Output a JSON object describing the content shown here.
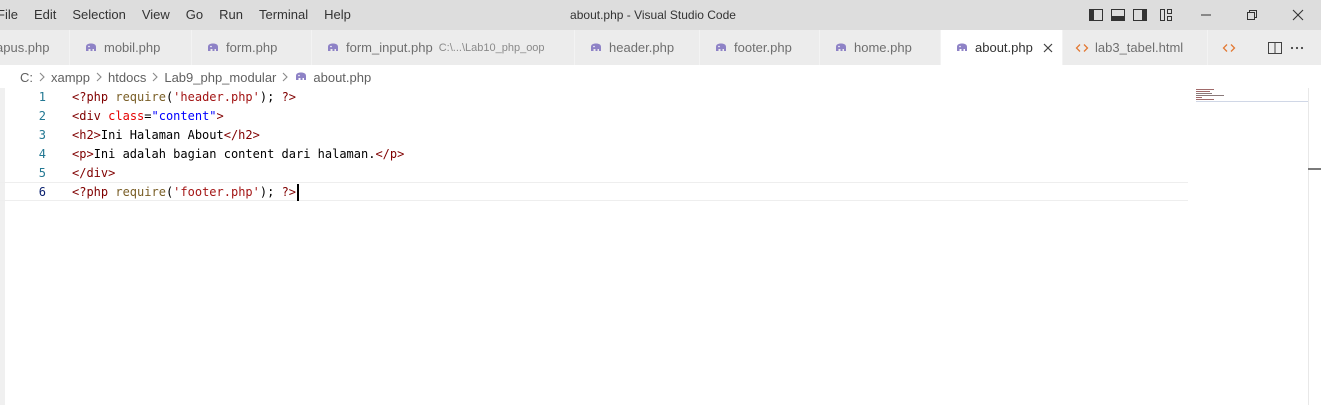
{
  "menu": [
    "File",
    "Edit",
    "Selection",
    "View",
    "Go",
    "Run",
    "Terminal",
    "Help"
  ],
  "window": {
    "title": "about.php - Visual Studio Code"
  },
  "tabs": [
    {
      "label": "apus.php",
      "icon": "php-elephant-icon",
      "desc": "",
      "active": false
    },
    {
      "label": "mobil.php",
      "icon": "php-elephant-icon",
      "desc": "",
      "active": false
    },
    {
      "label": "form.php",
      "icon": "php-elephant-icon",
      "desc": "",
      "active": false
    },
    {
      "label": "form_input.php",
      "icon": "php-elephant-icon",
      "desc": "C:\\...\\Lab10_php_oop",
      "active": false
    },
    {
      "label": "header.php",
      "icon": "php-elephant-icon",
      "desc": "",
      "active": false
    },
    {
      "label": "footer.php",
      "icon": "php-elephant-icon",
      "desc": "",
      "active": false
    },
    {
      "label": "home.php",
      "icon": "php-elephant-icon",
      "desc": "",
      "active": false
    },
    {
      "label": "about.php",
      "icon": "php-elephant-icon",
      "desc": "",
      "active": true
    },
    {
      "label": "lab3_tabel.html",
      "icon": "html-brackets-icon",
      "desc": "",
      "active": false
    }
  ],
  "breadcrumb": [
    "C:",
    "xampp",
    "htdocs",
    "Lab9_php_modular",
    "about.php"
  ],
  "editor": {
    "current_line": 6,
    "lines": [
      {
        "n": "1",
        "text": "<?php require('header.php'); ?>"
      },
      {
        "n": "2",
        "text": "<div class=\"content\">"
      },
      {
        "n": "3",
        "text": "<h2>Ini Halaman About</h2>"
      },
      {
        "n": "4",
        "text": "<p>Ini adalah bagian content dari halaman.</p>"
      },
      {
        "n": "5",
        "text": "</div>"
      },
      {
        "n": "6",
        "text": "<?php require('footer.php'); ?>"
      }
    ]
  },
  "colors": {
    "php_icon": "#8e82c6",
    "html_icon": "#e37933",
    "tag": "#800000",
    "attr": "#e50000",
    "string": "#a31515",
    "function": "#795e26",
    "line_number": "#237893"
  }
}
